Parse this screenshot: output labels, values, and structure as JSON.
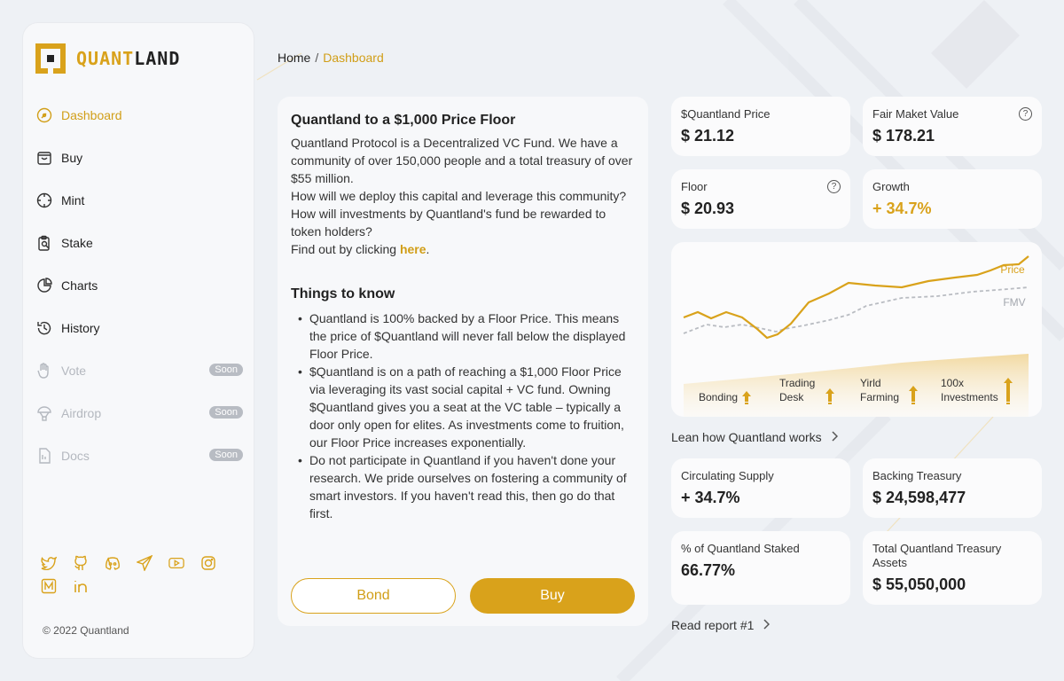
{
  "brand": {
    "name_part1": "QUANT",
    "name_part2": "LAND"
  },
  "sidebar": {
    "items": [
      {
        "label": "Dashboard",
        "icon": "dashboard-icon"
      },
      {
        "label": "Buy",
        "icon": "bag-icon"
      },
      {
        "label": "Mint",
        "icon": "crosshair-icon"
      },
      {
        "label": "Stake",
        "icon": "clipboard-icon"
      },
      {
        "label": "Charts",
        "icon": "pie-chart-icon"
      },
      {
        "label": "History",
        "icon": "history-icon"
      },
      {
        "label": "Vote",
        "icon": "hand-icon",
        "badge": "Soon"
      },
      {
        "label": "Airdrop",
        "icon": "parachute-icon",
        "badge": "Soon"
      },
      {
        "label": "Docs",
        "icon": "document-icon",
        "badge": "Soon"
      }
    ],
    "socials": [
      "twitter-icon",
      "github-icon",
      "discord-icon",
      "telegram-icon",
      "youtube-icon",
      "instagram-icon",
      "medium-icon",
      "linkedin-icon"
    ],
    "copyright": "© 2022 Quantland"
  },
  "breadcrumb": {
    "home": "Home",
    "sep": "/",
    "current": "Dashboard"
  },
  "main": {
    "title": "Quantland to a $1,000 Price Floor",
    "p1": "Quantland Protocol is a Decentralized VC Fund. We have a community of over 150,000 people and a total treasury of over $55 million.",
    "p2": "How will we deploy this capital and leverage this community? How will investments by Quantland's fund be rewarded to token holders?",
    "p3_prefix": "Find out by clicking ",
    "p3_link": "here",
    "p3_suffix": ".",
    "things_title": "Things to know",
    "bullets": [
      "Quantland is 100% backed by a Floor Price. This means the price of $Quantland will never fall below the displayed Floor Price.",
      "$Quantland is on a path of reaching a $1,000 Floor Price via leveraging its vast social capital + VC fund. Owning $Quantland gives you a seat at the VC table – typically a door only open for elites. As investments come to fruition, our Floor Price increases exponentially.",
      "Do not participate in Quantland if you haven't done your research. We pride ourselves on fostering a community of smart investors. If you haven't read this, then go do that first."
    ],
    "bond_label": "Bond",
    "buy_label": "Buy"
  },
  "stats": {
    "price": {
      "label": "$Quantland Price",
      "value": "$ 21.12"
    },
    "fmv": {
      "label": "Fair Maket Value",
      "value": "$ 178.21"
    },
    "floor": {
      "label": "Floor",
      "value": "$ 20.93"
    },
    "growth": {
      "label": "Growth",
      "value": "+ 34.7%"
    },
    "circ": {
      "label": "Circulating Supply",
      "value": "+ 34.7%"
    },
    "backing": {
      "label": "Backing Treasury",
      "value": "$ 24,598,477"
    },
    "staked": {
      "label": "% of Quantland Staked",
      "value": "66.77%"
    },
    "total": {
      "label": "Total Quantland Treasury Assets",
      "value": "$ 55,050,000"
    }
  },
  "chart": {
    "price_label": "Price",
    "fmv_label": "FMV",
    "stages": [
      {
        "line1": "Bonding",
        "line2": ""
      },
      {
        "line1": "Trading",
        "line2": "Desk"
      },
      {
        "line1": "Yirld",
        "line2": "Farming"
      },
      {
        "line1": "100x",
        "line2": "Investments"
      }
    ],
    "price_color": "#d9a21b",
    "fmv_color": "#b9bcc2"
  },
  "links": {
    "learn": "Lean how Quantland works",
    "report": "Read report #1"
  }
}
